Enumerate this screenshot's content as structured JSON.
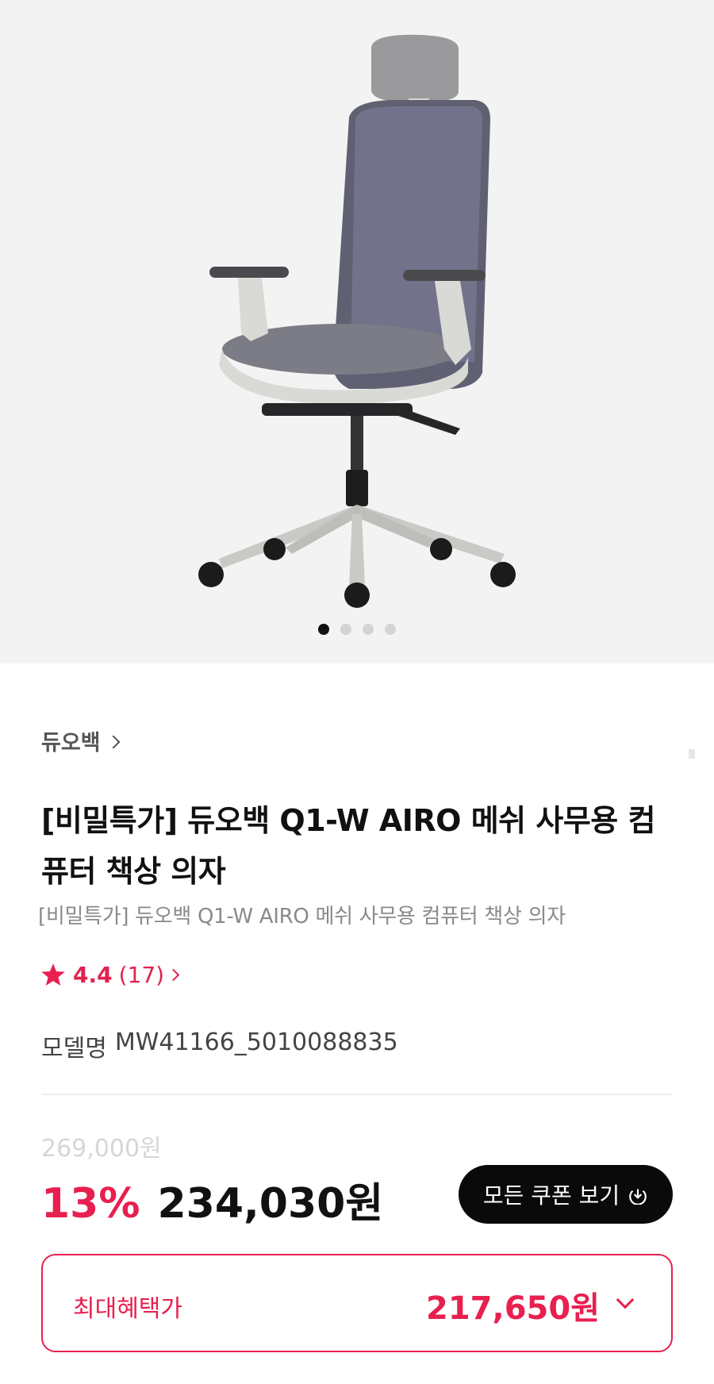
{
  "product": {
    "brand": "듀오백",
    "title": "[비밀특가] 듀오백 Q1-W AIRO 메쉬 사무용 컴퓨터 책상 의자",
    "subtitle": "[비밀특가] 듀오백 Q1-W AIRO 메쉬 사무용 컴퓨터 책상 의자",
    "rating": "4.4",
    "review_count": "(17)",
    "model_label": "모델명",
    "model_number": "MW41166_5010088835"
  },
  "carousel": {
    "total": 4,
    "current": 1
  },
  "pricing": {
    "original": "269,000원",
    "discount": "13%",
    "price": "234,030원",
    "coupon_button": "모든 쿠폰 보기",
    "benefit_label": "최대혜택가",
    "benefit_price": "217,650원"
  },
  "colors": {
    "accent": "#e8204f",
    "button_bg": "#0a0a0a"
  },
  "icons": [
    "chair-image",
    "chevron-right-icon",
    "star-icon",
    "download-icon",
    "chevron-down-icon"
  ]
}
